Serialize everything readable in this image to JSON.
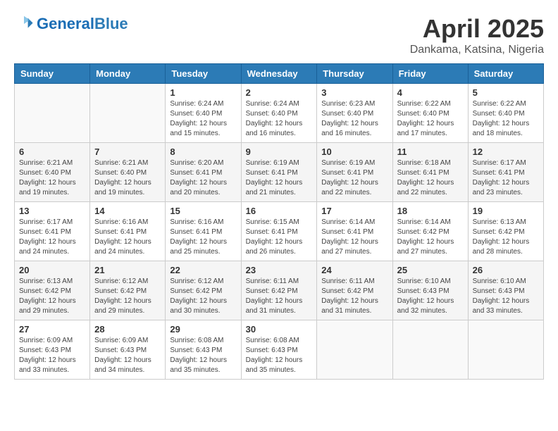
{
  "header": {
    "logo_general": "General",
    "logo_blue": "Blue",
    "month": "April 2025",
    "location": "Dankama, Katsina, Nigeria"
  },
  "days_of_week": [
    "Sunday",
    "Monday",
    "Tuesday",
    "Wednesday",
    "Thursday",
    "Friday",
    "Saturday"
  ],
  "weeks": [
    [
      {
        "day": "",
        "sunrise": "",
        "sunset": "",
        "daylight": ""
      },
      {
        "day": "",
        "sunrise": "",
        "sunset": "",
        "daylight": ""
      },
      {
        "day": "1",
        "sunrise": "Sunrise: 6:24 AM",
        "sunset": "Sunset: 6:40 PM",
        "daylight": "Daylight: 12 hours and 15 minutes."
      },
      {
        "day": "2",
        "sunrise": "Sunrise: 6:24 AM",
        "sunset": "Sunset: 6:40 PM",
        "daylight": "Daylight: 12 hours and 16 minutes."
      },
      {
        "day": "3",
        "sunrise": "Sunrise: 6:23 AM",
        "sunset": "Sunset: 6:40 PM",
        "daylight": "Daylight: 12 hours and 16 minutes."
      },
      {
        "day": "4",
        "sunrise": "Sunrise: 6:22 AM",
        "sunset": "Sunset: 6:40 PM",
        "daylight": "Daylight: 12 hours and 17 minutes."
      },
      {
        "day": "5",
        "sunrise": "Sunrise: 6:22 AM",
        "sunset": "Sunset: 6:40 PM",
        "daylight": "Daylight: 12 hours and 18 minutes."
      }
    ],
    [
      {
        "day": "6",
        "sunrise": "Sunrise: 6:21 AM",
        "sunset": "Sunset: 6:40 PM",
        "daylight": "Daylight: 12 hours and 19 minutes."
      },
      {
        "day": "7",
        "sunrise": "Sunrise: 6:21 AM",
        "sunset": "Sunset: 6:40 PM",
        "daylight": "Daylight: 12 hours and 19 minutes."
      },
      {
        "day": "8",
        "sunrise": "Sunrise: 6:20 AM",
        "sunset": "Sunset: 6:41 PM",
        "daylight": "Daylight: 12 hours and 20 minutes."
      },
      {
        "day": "9",
        "sunrise": "Sunrise: 6:19 AM",
        "sunset": "Sunset: 6:41 PM",
        "daylight": "Daylight: 12 hours and 21 minutes."
      },
      {
        "day": "10",
        "sunrise": "Sunrise: 6:19 AM",
        "sunset": "Sunset: 6:41 PM",
        "daylight": "Daylight: 12 hours and 22 minutes."
      },
      {
        "day": "11",
        "sunrise": "Sunrise: 6:18 AM",
        "sunset": "Sunset: 6:41 PM",
        "daylight": "Daylight: 12 hours and 22 minutes."
      },
      {
        "day": "12",
        "sunrise": "Sunrise: 6:17 AM",
        "sunset": "Sunset: 6:41 PM",
        "daylight": "Daylight: 12 hours and 23 minutes."
      }
    ],
    [
      {
        "day": "13",
        "sunrise": "Sunrise: 6:17 AM",
        "sunset": "Sunset: 6:41 PM",
        "daylight": "Daylight: 12 hours and 24 minutes."
      },
      {
        "day": "14",
        "sunrise": "Sunrise: 6:16 AM",
        "sunset": "Sunset: 6:41 PM",
        "daylight": "Daylight: 12 hours and 24 minutes."
      },
      {
        "day": "15",
        "sunrise": "Sunrise: 6:16 AM",
        "sunset": "Sunset: 6:41 PM",
        "daylight": "Daylight: 12 hours and 25 minutes."
      },
      {
        "day": "16",
        "sunrise": "Sunrise: 6:15 AM",
        "sunset": "Sunset: 6:41 PM",
        "daylight": "Daylight: 12 hours and 26 minutes."
      },
      {
        "day": "17",
        "sunrise": "Sunrise: 6:14 AM",
        "sunset": "Sunset: 6:41 PM",
        "daylight": "Daylight: 12 hours and 27 minutes."
      },
      {
        "day": "18",
        "sunrise": "Sunrise: 6:14 AM",
        "sunset": "Sunset: 6:42 PM",
        "daylight": "Daylight: 12 hours and 27 minutes."
      },
      {
        "day": "19",
        "sunrise": "Sunrise: 6:13 AM",
        "sunset": "Sunset: 6:42 PM",
        "daylight": "Daylight: 12 hours and 28 minutes."
      }
    ],
    [
      {
        "day": "20",
        "sunrise": "Sunrise: 6:13 AM",
        "sunset": "Sunset: 6:42 PM",
        "daylight": "Daylight: 12 hours and 29 minutes."
      },
      {
        "day": "21",
        "sunrise": "Sunrise: 6:12 AM",
        "sunset": "Sunset: 6:42 PM",
        "daylight": "Daylight: 12 hours and 29 minutes."
      },
      {
        "day": "22",
        "sunrise": "Sunrise: 6:12 AM",
        "sunset": "Sunset: 6:42 PM",
        "daylight": "Daylight: 12 hours and 30 minutes."
      },
      {
        "day": "23",
        "sunrise": "Sunrise: 6:11 AM",
        "sunset": "Sunset: 6:42 PM",
        "daylight": "Daylight: 12 hours and 31 minutes."
      },
      {
        "day": "24",
        "sunrise": "Sunrise: 6:11 AM",
        "sunset": "Sunset: 6:42 PM",
        "daylight": "Daylight: 12 hours and 31 minutes."
      },
      {
        "day": "25",
        "sunrise": "Sunrise: 6:10 AM",
        "sunset": "Sunset: 6:43 PM",
        "daylight": "Daylight: 12 hours and 32 minutes."
      },
      {
        "day": "26",
        "sunrise": "Sunrise: 6:10 AM",
        "sunset": "Sunset: 6:43 PM",
        "daylight": "Daylight: 12 hours and 33 minutes."
      }
    ],
    [
      {
        "day": "27",
        "sunrise": "Sunrise: 6:09 AM",
        "sunset": "Sunset: 6:43 PM",
        "daylight": "Daylight: 12 hours and 33 minutes."
      },
      {
        "day": "28",
        "sunrise": "Sunrise: 6:09 AM",
        "sunset": "Sunset: 6:43 PM",
        "daylight": "Daylight: 12 hours and 34 minutes."
      },
      {
        "day": "29",
        "sunrise": "Sunrise: 6:08 AM",
        "sunset": "Sunset: 6:43 PM",
        "daylight": "Daylight: 12 hours and 35 minutes."
      },
      {
        "day": "30",
        "sunrise": "Sunrise: 6:08 AM",
        "sunset": "Sunset: 6:43 PM",
        "daylight": "Daylight: 12 hours and 35 minutes."
      },
      {
        "day": "",
        "sunrise": "",
        "sunset": "",
        "daylight": ""
      },
      {
        "day": "",
        "sunrise": "",
        "sunset": "",
        "daylight": ""
      },
      {
        "day": "",
        "sunrise": "",
        "sunset": "",
        "daylight": ""
      }
    ]
  ]
}
